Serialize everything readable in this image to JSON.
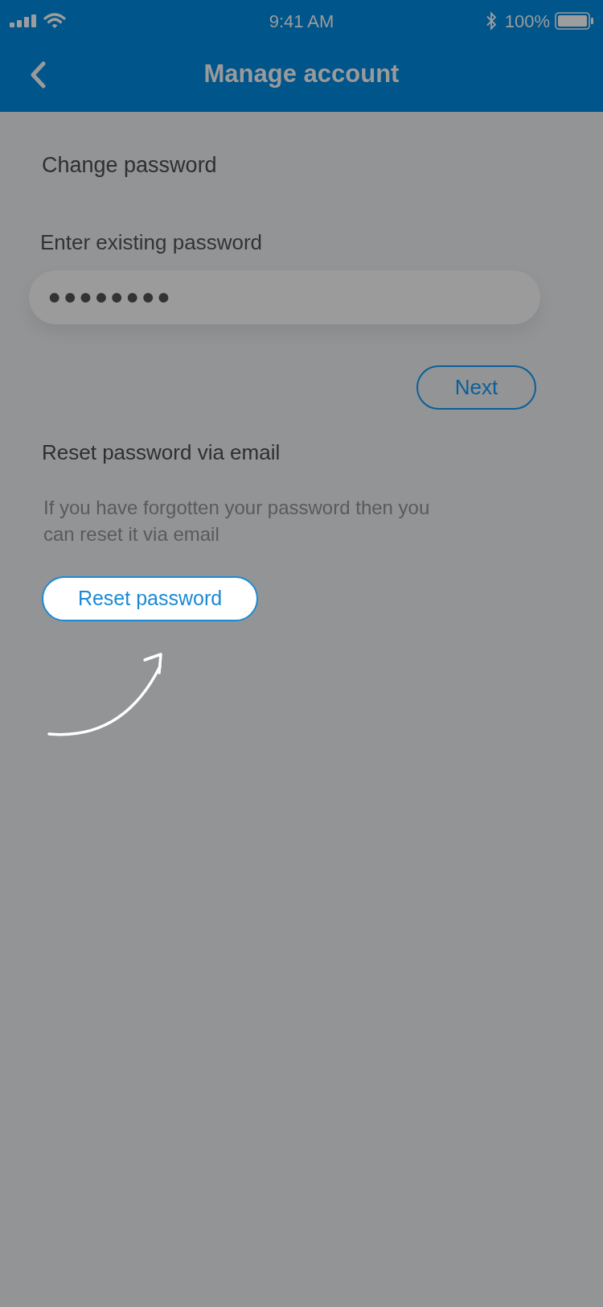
{
  "status_bar": {
    "time": "9:41 AM",
    "battery": "100%"
  },
  "header": {
    "title": "Manage account"
  },
  "change_password": {
    "title": "Change password",
    "field_label": "Enter existing password",
    "field_value": "••••••••",
    "button": "Next"
  },
  "reset_password": {
    "title": "Reset password via email",
    "description": "If you have forgotten your password then you can reset it via email",
    "button": "Reset password"
  }
}
